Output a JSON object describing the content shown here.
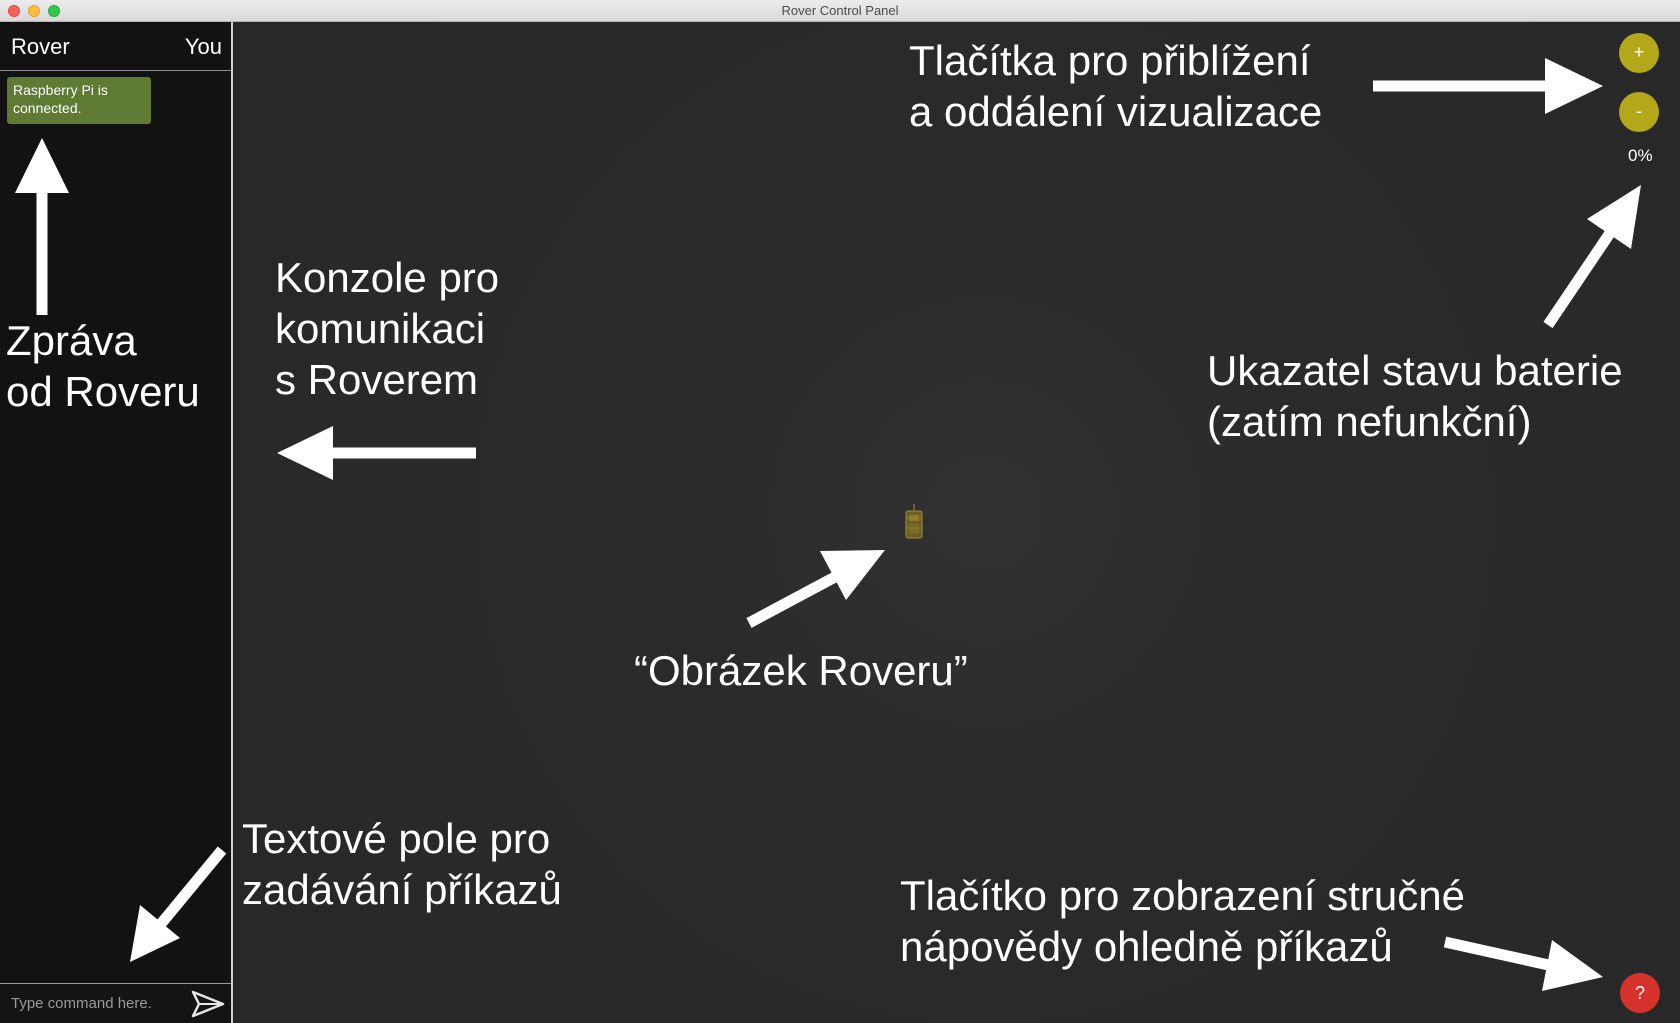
{
  "window": {
    "title": "Rover Control Panel"
  },
  "sidebar": {
    "header_left": "Rover",
    "header_right": "You",
    "messages": [
      {
        "from": "rover",
        "text": "Raspberry Pi is connected."
      }
    ],
    "command_input": {
      "value": "",
      "placeholder": "Type command here."
    },
    "send_icon": "paper-plane-icon"
  },
  "controls": {
    "zoom_in_label": "+",
    "zoom_out_label": "-",
    "battery_text": "0%",
    "help_label": "?"
  },
  "annotations": {
    "message_from_rover": "Zpráva\nod Roveru",
    "console": "Konzole pro\nkomunikaci\ns Roverem",
    "zoom_buttons": "Tlačítka pro přiblížení\na oddálení vizualizace",
    "battery": "Ukazatel stavu baterie\n(zatím nefunkční)",
    "rover_image": "“Obrázek Roveru”",
    "command_field": "Textové pole pro\nzadávání příkazů",
    "help_button": "Tlačítko pro zobrazení stručné\nnápovědy ohledně příkazů"
  },
  "colors": {
    "background": "#2a2a2a",
    "sidebar": "#121212",
    "message_bubble": "#5e7a33",
    "zoom_buttons": "#b3a71a",
    "help_button": "#d4322a"
  }
}
